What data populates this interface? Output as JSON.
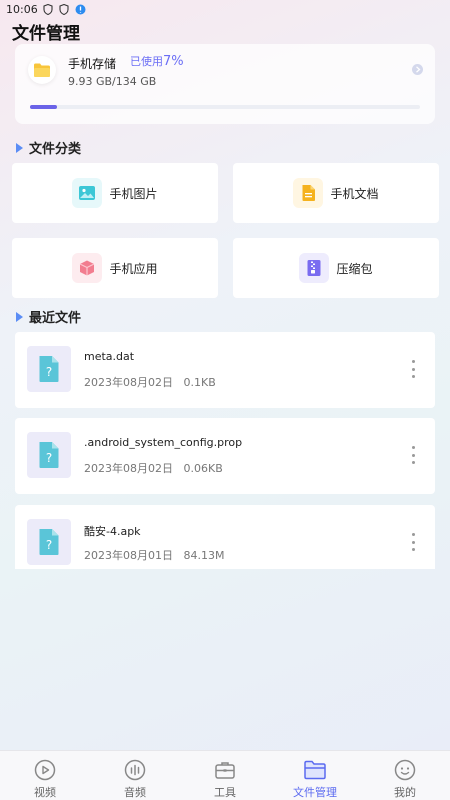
{
  "status_bar": {
    "time": "10:06"
  },
  "page_title": "文件管理",
  "storage": {
    "name": "手机存储",
    "used_label": "已使用",
    "used_percent": "7%",
    "size_text": "9.93 GB/134 GB",
    "progress_fraction": 0.07
  },
  "categories_section": {
    "title": "文件分类",
    "items": [
      {
        "label": "手机图片",
        "icon": "image-icon"
      },
      {
        "label": "手机文档",
        "icon": "document-icon"
      },
      {
        "label": "手机应用",
        "icon": "app-cube-icon"
      },
      {
        "label": "压缩包",
        "icon": "zip-icon"
      }
    ]
  },
  "recent_section": {
    "title": "最近文件",
    "files": [
      {
        "name": "meta.dat",
        "date": "2023年08月02日",
        "size": "0.1KB"
      },
      {
        "name": ".android_system_config.prop",
        "date": "2023年08月02日",
        "size": "0.06KB"
      },
      {
        "name": "酷安-4.apk",
        "date": "2023年08月01日",
        "size": "84.13M"
      }
    ]
  },
  "tabs": [
    {
      "label": "视频",
      "icon": "video-play-icon"
    },
    {
      "label": "音频",
      "icon": "audio-bars-icon"
    },
    {
      "label": "工具",
      "icon": "toolbox-icon"
    },
    {
      "label": "文件管理",
      "icon": "folder-icon",
      "active": true
    },
    {
      "label": "我的",
      "icon": "profile-face-icon"
    }
  ],
  "colors": {
    "accent": "#5b6af0",
    "progress": "#6b63e8",
    "section_marker": "#5b8df5",
    "image_icon": "#3cc7d6",
    "document_icon": "#f5b21e",
    "app_icon": "#f27d8f",
    "zip_icon": "#7a6cf0"
  }
}
